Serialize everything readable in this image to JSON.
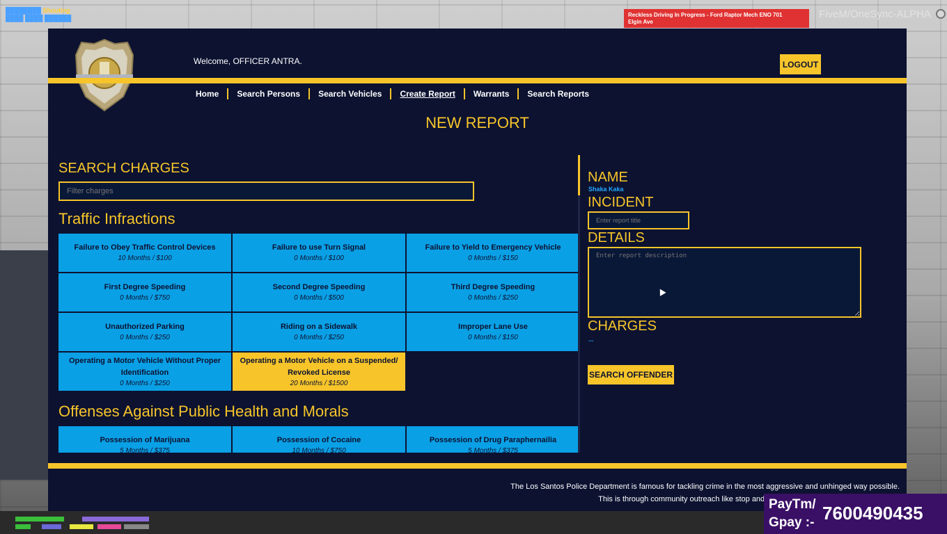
{
  "hud": {
    "top_left_line1_a": "████████",
    "top_left_line1_b": "Shouting",
    "top_left_line2": "████ ████ ██████",
    "alert_line1": "Reckless Driving In Progress - Ford Raptor Mech ENO 701",
    "alert_line2": "Elgin Ave",
    "server": "FiveM/OneSync-ALPHA"
  },
  "header": {
    "welcome": "Welcome, OFFICER ANTRA.",
    "logout": "LOGOUT",
    "nav": [
      "Home",
      "Search Persons",
      "Search Vehicles",
      "Create Report",
      "Warrants",
      "Search Reports"
    ],
    "active_nav": "Create Report"
  },
  "page_title": "NEW REPORT",
  "left": {
    "search_heading": "SEARCH CHARGES",
    "filter_placeholder": "Filter charges",
    "categories": [
      {
        "title": "Traffic Infractions",
        "charges": [
          {
            "name": "Failure to Obey Traffic Control Devices",
            "penalty": "10 Months / $100"
          },
          {
            "name": "Failure to use Turn Signal",
            "penalty": "0 Months / $100"
          },
          {
            "name": "Failure to Yield to Emergency Vehicle",
            "penalty": "0 Months / $150"
          },
          {
            "name": "First Degree Speeding",
            "penalty": "0 Months / $750"
          },
          {
            "name": "Second Degree Speeding",
            "penalty": "0 Months / $500"
          },
          {
            "name": "Third Degree Speeding",
            "penalty": "0 Months / $250"
          },
          {
            "name": "Unauthorized Parking",
            "penalty": "0 Months / $250"
          },
          {
            "name": "Riding on a Sidewalk",
            "penalty": "0 Months / $250"
          },
          {
            "name": "Improper Lane Use",
            "penalty": "0 Months / $150"
          },
          {
            "name": "Operating a Motor Vehicle Without Proper Identification",
            "penalty": "0 Months / $250"
          },
          {
            "name": "Operating a Motor Vehicle on a Suspended/ Revoked License",
            "penalty": "20 Months / $1500",
            "selected": true
          }
        ]
      },
      {
        "title": "Offenses Against Public Health and Morals",
        "charges": [
          {
            "name": "Possession of Marijuana",
            "penalty": "5 Months / $375"
          },
          {
            "name": "Possession of Cocaine",
            "penalty": "10 Months / $750"
          },
          {
            "name": "Possession of Drug Paraphernailia",
            "penalty": "5 Months / $375"
          }
        ]
      }
    ]
  },
  "right": {
    "name_label": "NAME",
    "name_value": "Shaka Kaka",
    "incident_label": "INCIDENT",
    "incident_placeholder": "Enter report title",
    "details_label": "DETAILS",
    "details_placeholder": "Enter report description",
    "charges_label": "CHARGES",
    "charges_value": "...",
    "search_offender": "SEARCH OFFENDER"
  },
  "footer": {
    "line1": "The Los Santos Police Department is famous for tackling crime in the most aggressive and unhinged way possible.",
    "line2": "This is through community outreach like stop and frisk, spectacular police chases, and lib"
  },
  "overlay": {
    "label1": "PayTm/",
    "label2": "Gpay :-",
    "number": "7600490435"
  },
  "colors": {
    "panel": "#0c1230",
    "gold": "#f7c52a",
    "charge_blue": "#0aa0e6",
    "link_blue": "#23a6ff",
    "alert_red": "#e03232"
  }
}
